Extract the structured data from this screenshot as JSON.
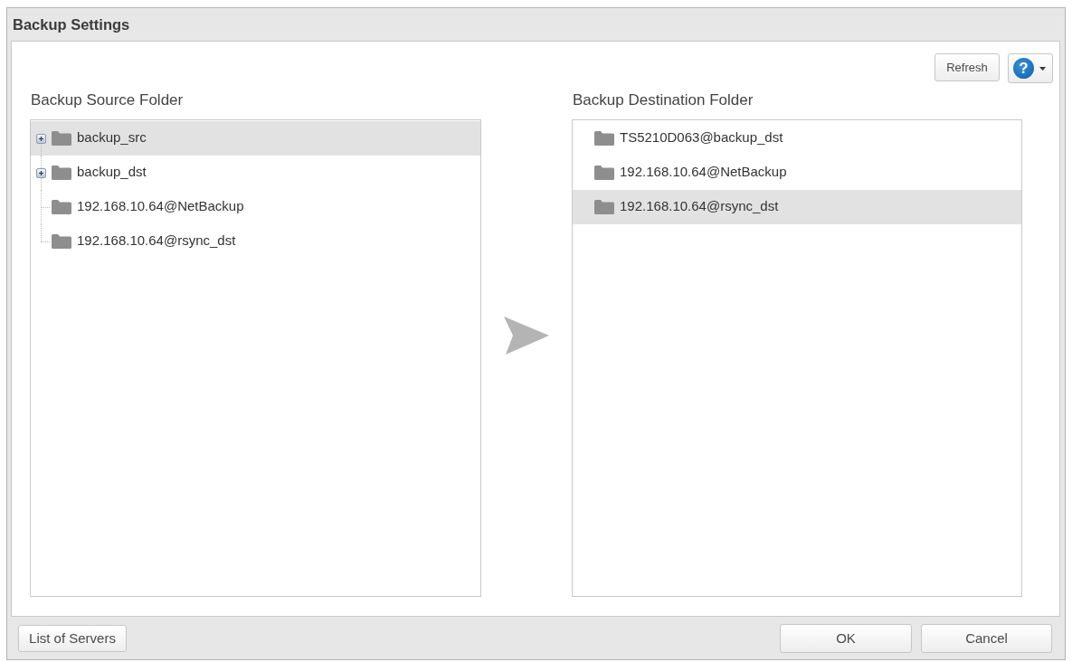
{
  "window": {
    "title": "Backup Settings"
  },
  "toolbar": {
    "refresh_button": "Refresh",
    "help_button": {
      "glyph": "?"
    }
  },
  "source_folder": {
    "label": "Backup Source Folder",
    "items": [
      {
        "name": "backup_src",
        "kind": "branch",
        "expanded": false,
        "selected": true
      },
      {
        "name": "backup_dst",
        "kind": "branch",
        "expanded": false,
        "selected": false
      },
      {
        "name": "192.168.10.64@NetBackup",
        "kind": "leaf",
        "selected": false
      },
      {
        "name": "192.168.10.64@rsync_dst",
        "kind": "leaf",
        "selected": false
      }
    ]
  },
  "destination_folder": {
    "label": "Backup Destination Folder",
    "items": [
      {
        "name": "TS5210D063@backup_dst",
        "selected": false
      },
      {
        "name": "192.168.10.64@NetBackup",
        "selected": false
      },
      {
        "name": "192.168.10.64@rsync_dst",
        "selected": true
      }
    ]
  },
  "footer": {
    "list_of_servers_button": "List of Servers",
    "buttons": [
      "OK",
      "Cancel"
    ]
  }
}
